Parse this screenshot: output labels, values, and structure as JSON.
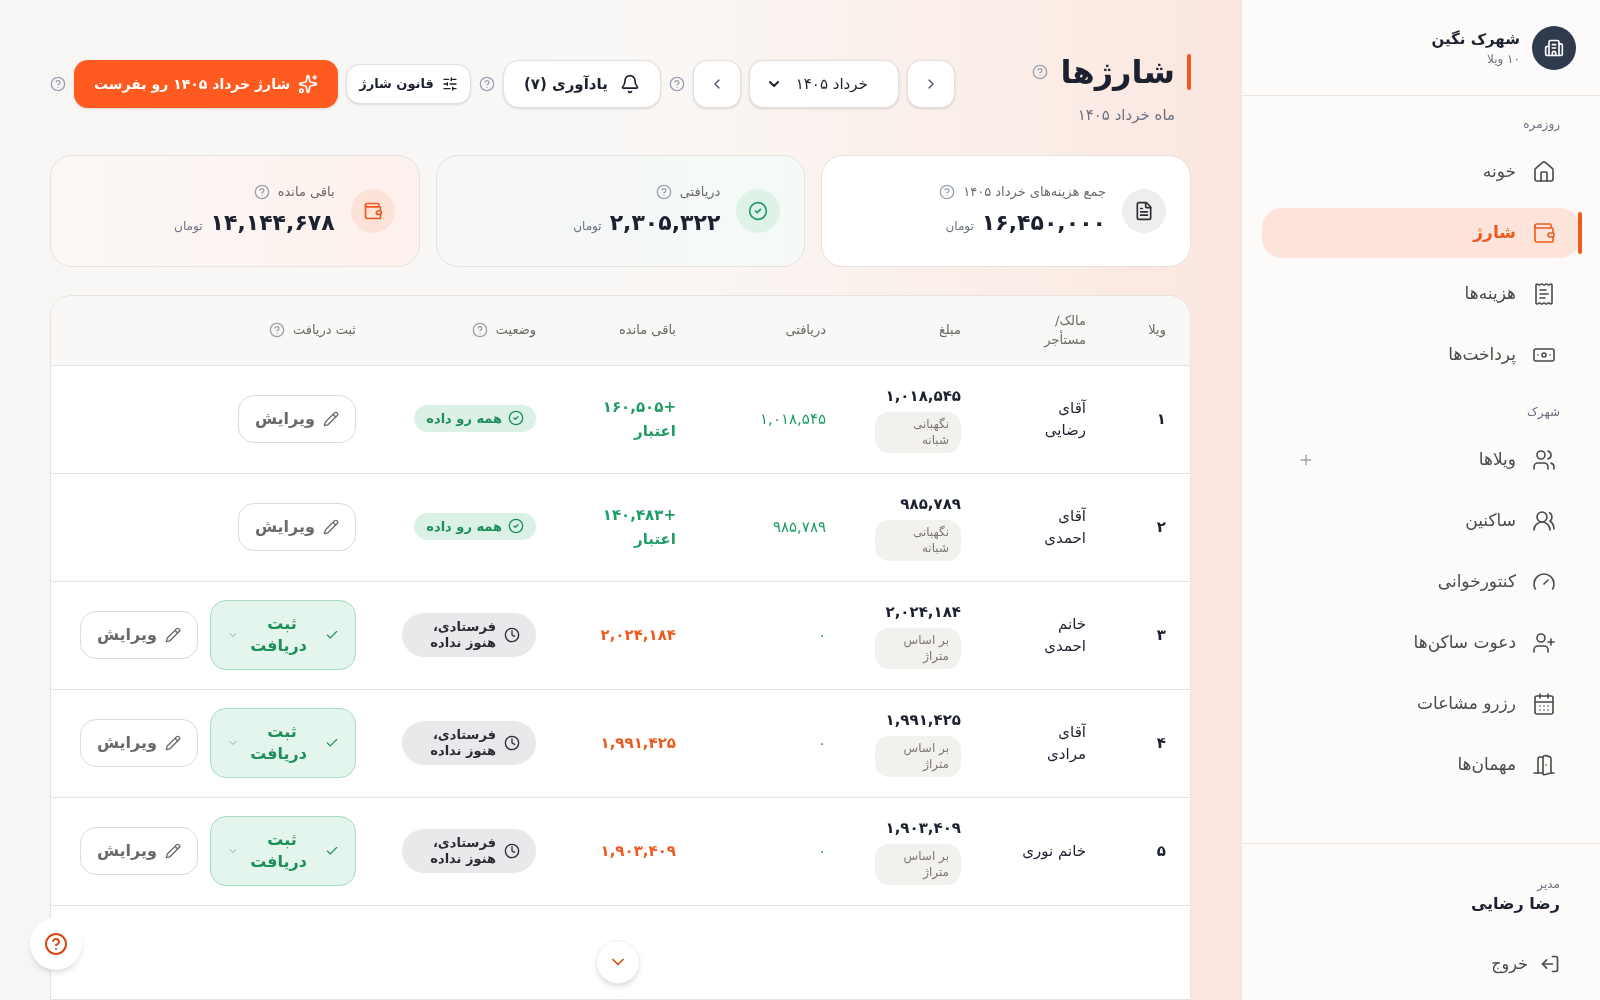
{
  "sidebar": {
    "org_name": "شهرک نگین",
    "org_sub": "۱۰ ویلا",
    "sections": [
      {
        "title": "روزمره",
        "items": [
          {
            "label": "خونه",
            "selected": false
          },
          {
            "label": "شارژ",
            "selected": true
          },
          {
            "label": "هزینه‌ها",
            "selected": false
          },
          {
            "label": "پرداخت‌ها",
            "selected": false
          }
        ]
      },
      {
        "title": "شهرک",
        "items": [
          {
            "label": "ویلاها",
            "selected": false,
            "add": true
          },
          {
            "label": "ساکنین",
            "selected": false
          },
          {
            "label": "کنتورخوانی",
            "selected": false
          },
          {
            "label": "دعوت ساکن‌ها",
            "selected": false
          },
          {
            "label": "رزرو مشاعات",
            "selected": false
          },
          {
            "label": "مهمان‌ها",
            "selected": false
          }
        ]
      }
    ],
    "user_role": "مدیر",
    "user_name": "رضا رضایی",
    "logout": "خروج"
  },
  "header": {
    "title": "شارژها",
    "subtitle": "ماه خرداد ۱۴۰۵",
    "month": "خرداد ۱۴۰۵",
    "reminder": "یادآوری (۷)",
    "rule": "قانون شارژ",
    "send": "شارژ خرداد ۱۴۰۵ رو بفرست"
  },
  "cards": [
    {
      "kind": "total",
      "label": "جمع هزینه‌های خرداد ۱۴۰۵",
      "value": "۱۶,۴۵۰,۰۰۰",
      "unit": "تومان"
    },
    {
      "kind": "received",
      "label": "دریافتی",
      "value": "۲,۳۰۵,۳۲۲",
      "unit": "تومان"
    },
    {
      "kind": "remaining",
      "label": "باقی مانده",
      "value": "۱۴,۱۴۴,۶۷۸",
      "unit": "تومان"
    }
  ],
  "table": {
    "columns": [
      "ویلا",
      "مالک/ مستأجر",
      "مبلغ",
      "دریافتی",
      "باقی مانده",
      "وضعیت",
      "ثبت دریافت"
    ],
    "rows": [
      {
        "villa": "۱",
        "owner": "آقای رضایی",
        "amount": "۱,۰۱۸,۵۴۵",
        "basis": "نگهبانی شبانه",
        "received": "۱,۰۱۸,۵۴۵",
        "remaining": {
          "kind": "credit",
          "text": "+۱۶۰,۵۰۵ اعتبار"
        },
        "status": {
          "kind": "paid",
          "text": "همه رو داده"
        },
        "edit": "ویرایش"
      },
      {
        "villa": "۲",
        "owner": "آقای احمدی",
        "amount": "۹۸۵,۷۸۹",
        "basis": "نگهبانی شبانه",
        "received": "۹۸۵,۷۸۹",
        "remaining": {
          "kind": "credit",
          "text": "+۱۴۰,۴۸۳ اعتبار"
        },
        "status": {
          "kind": "paid",
          "text": "همه رو داده"
        },
        "edit": "ویرایش"
      },
      {
        "villa": "۳",
        "owner": "خانم احمدی",
        "amount": "۲,۰۲۴,۱۸۴",
        "basis": "بر اساس متراژ",
        "received": "۰",
        "remaining": {
          "kind": "debt",
          "text": "۲,۰۲۴,۱۸۴"
        },
        "status": {
          "kind": "pending",
          "text": "فرستادی، هنوز نداده"
        },
        "register": "ثبت دریافت",
        "edit": "ویرایش"
      },
      {
        "villa": "۴",
        "owner": "آقای مرادی",
        "amount": "۱,۹۹۱,۴۲۵",
        "basis": "بر اساس متراژ",
        "received": "۰",
        "remaining": {
          "kind": "debt",
          "text": "۱,۹۹۱,۴۲۵"
        },
        "status": {
          "kind": "pending",
          "text": "فرستادی، هنوز نداده"
        },
        "register": "ثبت دریافت",
        "edit": "ویرایش"
      },
      {
        "villa": "۵",
        "owner": "خانم نوری",
        "amount": "۱,۹۰۳,۴۰۹",
        "basis": "بر اساس متراژ",
        "received": "۰",
        "remaining": {
          "kind": "debt",
          "text": "۱,۹۰۳,۴۰۹"
        },
        "status": {
          "kind": "pending",
          "text": "فرستادی، هنوز نداده"
        },
        "register": "ثبت دریافت",
        "edit": "ویرایش"
      }
    ]
  }
}
